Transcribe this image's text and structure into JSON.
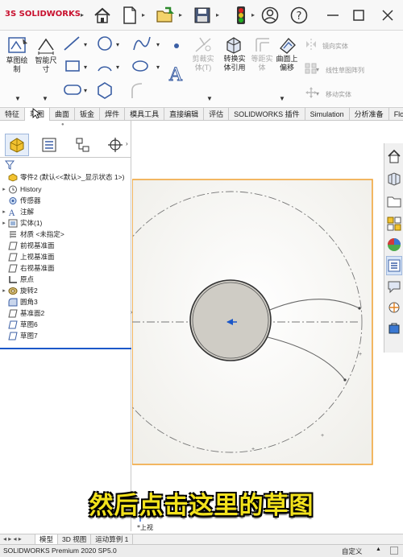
{
  "app": {
    "logo_prefix": "3S",
    "logo_text": "SOLIDWORKS",
    "status_version": "SOLIDWORKS Premium 2020 SP5.0",
    "status_custom": "自定义",
    "status_caret": "▲"
  },
  "ribbon": {
    "sketch_draw": "草图绘\n制",
    "smart_dim": "智能尺\n寸",
    "trim": "剪裁实\n体(T)",
    "convert": "转换实\n体引用",
    "offset_eq": "等距实\n体",
    "offset_surface": "曲面上\n偏移",
    "mirror": "镜向实体",
    "linear_pattern": "线性草图阵列",
    "move": "移动实体"
  },
  "tabs": [
    "特征",
    "草图",
    "曲面",
    "钣金",
    "焊件",
    "模具工具",
    "直接编辑",
    "评估",
    "SOLIDWORKS 插件",
    "Simulation",
    "分析准备",
    "Flo..."
  ],
  "active_tab": "草图",
  "tree": {
    "root": "零件2 (默认<<默认>_显示状态 1>)",
    "items": [
      {
        "label": "History",
        "exp": "▸"
      },
      {
        "label": "传感器",
        "exp": ""
      },
      {
        "label": "注解",
        "exp": "▸"
      },
      {
        "label": "实体(1)",
        "exp": "▸"
      },
      {
        "label": "材质 <未指定>",
        "exp": ""
      },
      {
        "label": "前视基准面",
        "exp": ""
      },
      {
        "label": "上视基准面",
        "exp": ""
      },
      {
        "label": "右视基准面",
        "exp": ""
      },
      {
        "label": "原点",
        "exp": ""
      },
      {
        "label": "旋转2",
        "exp": "▸"
      },
      {
        "label": "圆角3",
        "exp": ""
      },
      {
        "label": "基准面2",
        "exp": ""
      },
      {
        "label": "草图6",
        "exp": ""
      },
      {
        "label": "草图7",
        "exp": ""
      }
    ]
  },
  "canvas": {
    "view_label": "*上视"
  },
  "bottom_tabs": [
    "模型",
    "3D 视图",
    "运动算例 1"
  ],
  "active_bottom_tab": "模型",
  "subtitle": "然后点击这里的草图",
  "colors": {
    "accent_orange": "#f0a030",
    "selection_blue": "#1b57c9",
    "subtitle_yellow": "#f2e21c"
  }
}
